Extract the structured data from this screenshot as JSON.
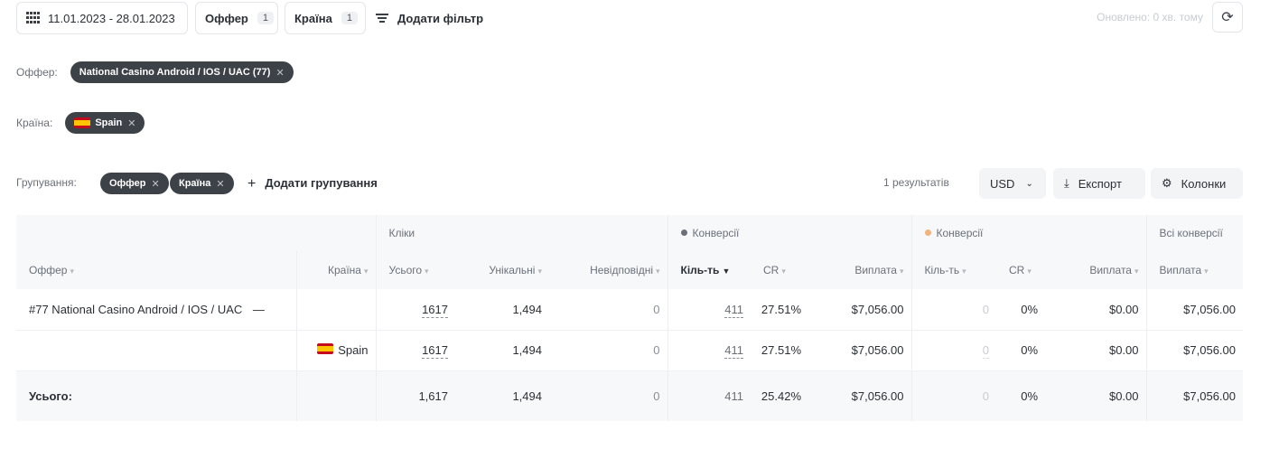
{
  "toolbar": {
    "date_range": "11.01.2023 - 28.01.2023",
    "offer_label": "Оффер",
    "offer_count": "1",
    "country_label": "Країна",
    "country_count": "1",
    "add_filter": "Додати фільтр",
    "updated": "Оновлено: 0 хв. тому",
    "refresh_icon": "refresh-icon"
  },
  "filters": {
    "offer_label": "Оффер:",
    "offer_chip": "National Casino Android / IOS / UAC (77)",
    "country_label": "Країна:",
    "country_chip": "Spain"
  },
  "grouping": {
    "label": "Групування:",
    "chips": [
      "Оффер",
      "Країна"
    ],
    "add_label": "Додати групування",
    "results": "1 результатів",
    "currency": "USD",
    "export": "Експорт",
    "columns": "Колонки"
  },
  "table": {
    "groups": {
      "clicks": "Кліки",
      "conv1": "Конверсії",
      "conv1_color": "#6b7079",
      "conv2": "Конверсії",
      "conv2_color": "#f0b37a",
      "all_conv": "Всі конверсії"
    },
    "headers": {
      "offer": "Оффер",
      "country": "Країна",
      "total": "Усього",
      "unique": "Унікальні",
      "unanswered": "Невідповідні",
      "count1": "Кіль-ть",
      "cr1": "CR",
      "payout1": "Виплата",
      "count2": "Кіль-ть",
      "cr2": "CR",
      "payout2": "Виплата",
      "payout_all": "Виплата"
    },
    "rows": [
      {
        "offer": "#77 National Casino Android / IOS / UAC",
        "collapse": "—",
        "country": "",
        "total": "1617",
        "unique": "1,494",
        "unanswered": "0",
        "count1": "411",
        "cr1": "27.51%",
        "payout1": "$7,056.00",
        "count2": "0",
        "cr2": "0%",
        "payout2": "$0.00",
        "payout_all": "$7,056.00"
      },
      {
        "offer": "",
        "country": "Spain",
        "total": "1617",
        "unique": "1,494",
        "unanswered": "0",
        "count1": "411",
        "cr1": "27.51%",
        "payout1": "$7,056.00",
        "count2": "0",
        "cr2": "0%",
        "payout2": "$0.00",
        "payout_all": "$7,056.00"
      }
    ],
    "totals": {
      "label": "Усього:",
      "total": "1,617",
      "unique": "1,494",
      "unanswered": "0",
      "count1": "411",
      "cr1": "25.42%",
      "payout1": "$7,056.00",
      "count2": "0",
      "cr2": "0%",
      "payout2": "$0.00",
      "payout_all": "$7,056.00"
    }
  }
}
